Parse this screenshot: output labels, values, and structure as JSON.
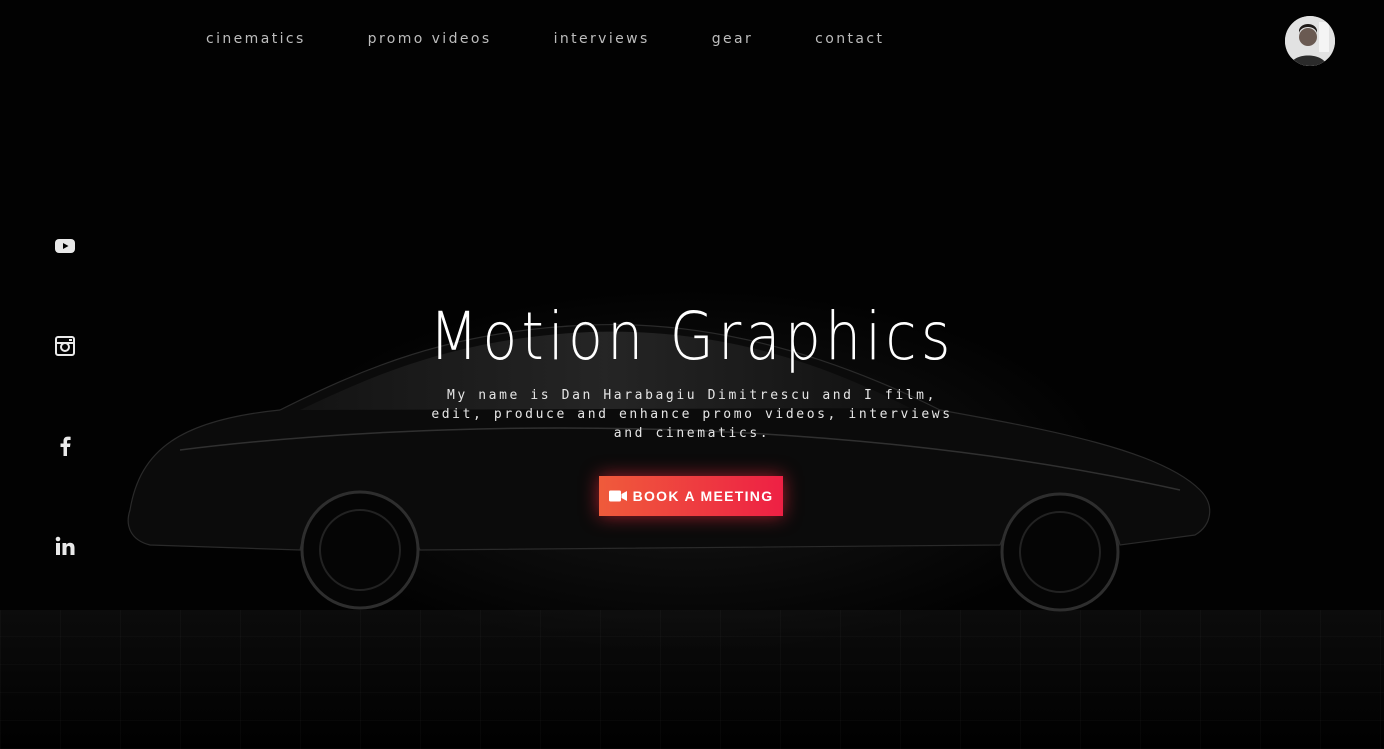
{
  "nav": {
    "items": [
      {
        "label": "cinematics"
      },
      {
        "label": "promo videos"
      },
      {
        "label": "interviews"
      },
      {
        "label": "gear"
      },
      {
        "label": "contact"
      }
    ]
  },
  "social": {
    "icons": [
      "youtube-icon",
      "instagram-icon",
      "facebook-icon",
      "linkedin-icon"
    ]
  },
  "hero": {
    "title": "Motion Graphics",
    "description": "My name is Dan Harabagiu Dimitrescu and I film, edit, produce and enhance promo videos, interviews and cinematics.",
    "cta_label": "BOOK A MEETING",
    "cta_icon": "video-camera-icon"
  },
  "colors": {
    "background": "#000000",
    "accent_start": "#ef5b3b",
    "accent_end": "#ee2044"
  }
}
